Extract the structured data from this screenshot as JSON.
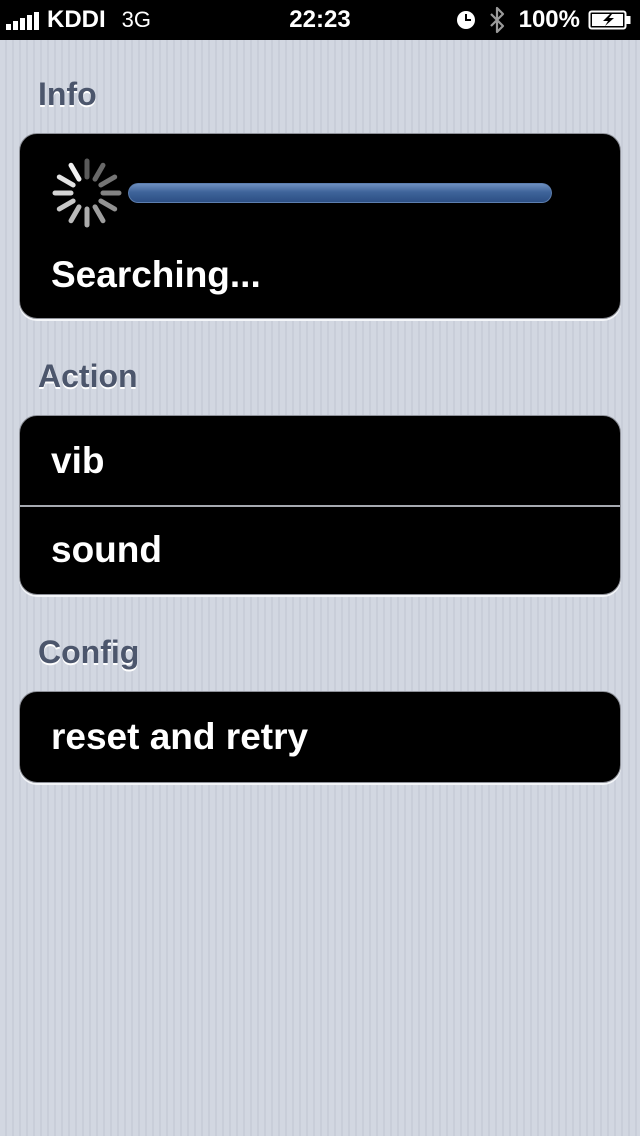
{
  "status_bar": {
    "carrier": "KDDI",
    "network": "3G",
    "time": "22:23",
    "battery_percent": "100%",
    "icons": [
      "signal-icon",
      "clock-icon",
      "bluetooth-icon",
      "battery-charging-icon"
    ]
  },
  "sections": {
    "info": {
      "header": "Info",
      "status_text": "Searching...",
      "progress": 1.0
    },
    "action": {
      "header": "Action",
      "items": [
        "vib",
        "sound"
      ]
    },
    "config": {
      "header": "Config",
      "items": [
        "reset and retry"
      ]
    }
  },
  "colors": {
    "background": "#cfd4de",
    "header_text": "#4c566c",
    "cell_background": "#000000",
    "cell_text": "#ffffff",
    "progress_fill": "#3f649a"
  }
}
